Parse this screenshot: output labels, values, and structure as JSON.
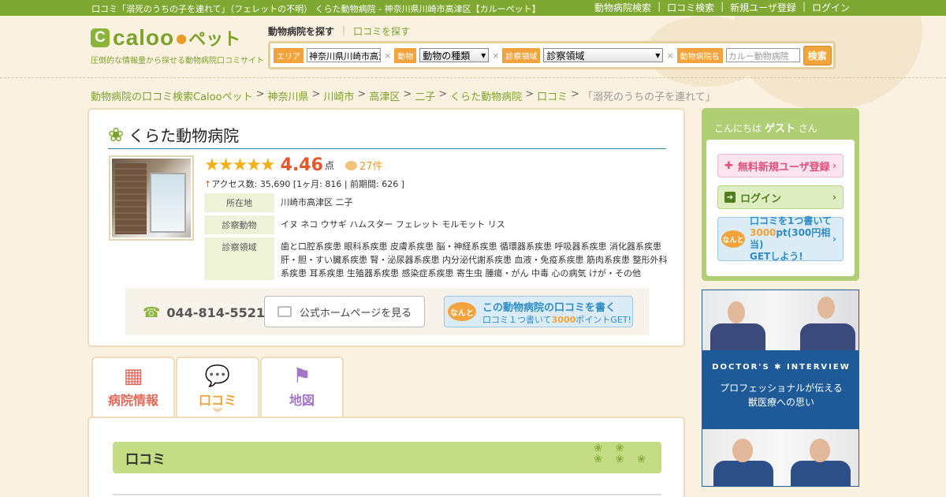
{
  "page": {
    "window_title": "口コミ「溺死のうちの子を連れて」（フェレットの不明） くらた動物病院 - 神奈川県川崎市高津区【カルーペット】"
  },
  "topnav": {
    "links": [
      "動物病院検索",
      "口コミ検索",
      "新規ユーザ登録",
      "ログイン"
    ],
    "separator": "|"
  },
  "logo": {
    "mark": "C",
    "word": "caloo",
    "pet": "ペット",
    "tagline": "圧倒的な情報量から探せる動物病院口コミサイト"
  },
  "search": {
    "tabs": [
      "動物病院を探す",
      "口コミを探す"
    ],
    "separator": "|",
    "area_label": "エリア",
    "area_value": "神奈川県川崎市高津",
    "animal_label": "動物",
    "animal_select": "動物の種類",
    "field_label": "診察領域",
    "field_select": "診察領域",
    "name_label": "動物病院名",
    "name_placeholder": "カルー動物病院",
    "button": "検索",
    "clear": "×"
  },
  "breadcrumb": {
    "items": [
      "動物病院の口コミ検索Calooペット",
      "神奈川県",
      "川崎市",
      "高津区",
      "二子",
      "くらた動物病院",
      "口コミ"
    ],
    "current": "「溺死のうちの子を連れて」",
    "separator": ">"
  },
  "hospital": {
    "name": "くらた動物病院",
    "stars": "★★★★★",
    "rating": "4.46",
    "rating_unit": "点",
    "review_count": "27件",
    "access_arrow": "↑",
    "access_text": "アクセス数: 35,690 [1ヶ月: 816 | 前期間: 626 ]",
    "info": [
      {
        "label": "所在地",
        "value": "川崎市高津区 二子"
      },
      {
        "label": "診察動物",
        "value": "イヌ ネコ ウサギ ハムスター フェレット モルモット リス"
      },
      {
        "label": "診察領域",
        "value": "歯と口腔系疾患 眼科系疾患 皮膚系疾患 脳・神経系疾患 循環器系疾患 呼吸器系疾患 消化器系疾患 肝・胆・すい臓系疾患 腎・泌尿器系疾患 内分泌代謝系疾患 血液・免疫系疾患 筋肉系疾患 整形外科系疾患 耳系疾患 生殖器系疾患 感染症系疾患 寄生虫 腫瘍・がん 中毒 心の病気 けが・その他"
      }
    ],
    "phone": "044-814-5521",
    "homepage_button": "公式ホームページを見る",
    "write_badge": "なんと",
    "write_line1": "この動物病院の口コミを書く",
    "write_line2a": "口コミ１つ書いて",
    "write_line2b": "3000",
    "write_line2c": "ポイントGET!"
  },
  "tabs": [
    {
      "label": "病院情報",
      "icon": "hospital-icon",
      "glyph": "▦"
    },
    {
      "label": "口コミ",
      "icon": "speech-bubble-icon",
      "glyph": "💬"
    },
    {
      "label": "地図",
      "icon": "map-flag-icon",
      "glyph": "⚑"
    }
  ],
  "review_section": {
    "title": "口コミ",
    "chevron": "︾"
  },
  "sidebar": {
    "greeting_pre": "こんにちは",
    "greeting_name": "ゲスト",
    "greeting_post": "さん",
    "register": "無料新規ユーザ登録",
    "login": "ログイン",
    "promo_badge": "なんと",
    "promo_line1": "口コミを1つ書いて",
    "promo_points": "3000",
    "promo_line2": "pt(300円相当)",
    "promo_line3": "GETしよう!"
  },
  "banner": {
    "title": "DOCTOR'S ✱ INTERVIEW",
    "line1": "プロフェッショナルが伝える",
    "line2": "獣医療への思い"
  },
  "colors": {
    "brand_green": "#7fa832",
    "accent_orange": "#f2a33b",
    "rating_red": "#e8562a",
    "link_blue": "#2e8cc7",
    "banner_navy": "#1e5a98"
  }
}
